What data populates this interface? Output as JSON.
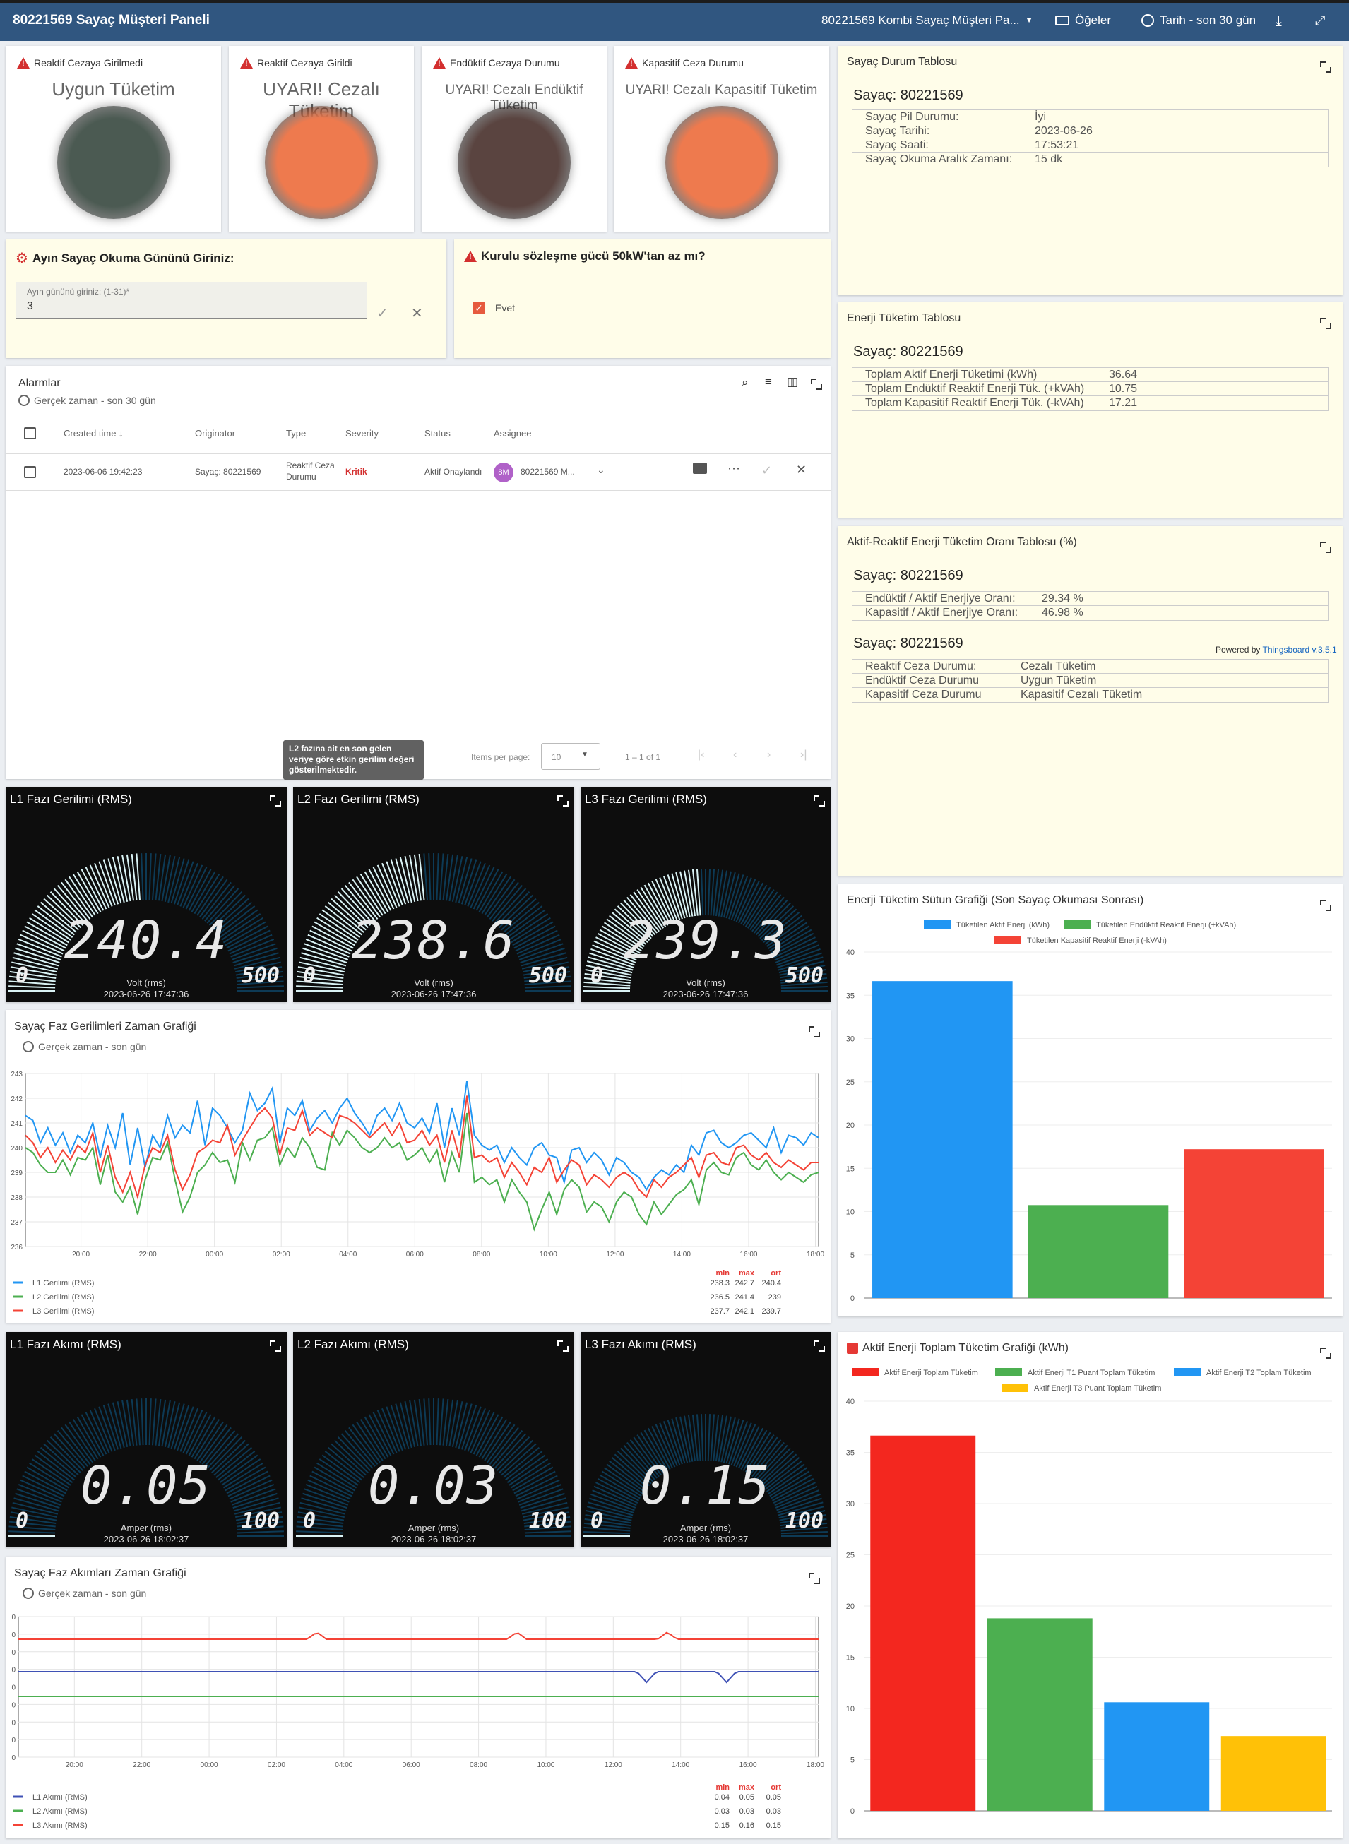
{
  "header": {
    "title": "80221569 Sayaç Müşteri Paneli",
    "dashboard_select": "80221569 Kombi Sayaç Müşteri Pa...",
    "entities": "Öğeler",
    "timewindow": "Tarih - son 30 gün"
  },
  "lamps": [
    {
      "label": "Reaktif Cezaya Girilmedi",
      "text": "Uygun Tüketim",
      "color": "#4b5a52"
    },
    {
      "label": "Reaktif Cezaya Girildi",
      "text": "UYARI! Cezalı Tüketim",
      "color": "#ee7a4e"
    },
    {
      "label": "Endüktif Cezaya Durumu",
      "text": "UYARI! Cezalı Endüktif Tüketim",
      "color": "#5a4440"
    },
    {
      "label": "Kapasitif Ceza Durumu",
      "text": "UYARI! Cezalı Kapasitif Tüketim",
      "color": "#ee7a4e"
    }
  ],
  "reading_day": {
    "title": "Ayın Sayaç Okuma Gününü Giriniz:",
    "field_label": "Ayın gününü giriniz: (1-31)*",
    "value": "3"
  },
  "contract": {
    "title": "Kurulu sözleşme gücü 50kW'tan az mı?",
    "checkbox_label": "Evet"
  },
  "alarms": {
    "title": "Alarmlar",
    "timewindow": "Gerçek zaman - son 30 gün",
    "columns": [
      "Created time",
      "Originator",
      "Type",
      "Severity",
      "Status",
      "Assignee"
    ],
    "row": {
      "time": "2023-06-06 19:42:23",
      "originator": "Sayaç: 80221569",
      "type": "Reaktif Ceza Durumu",
      "severity": "Kritik",
      "status": "Aktif Onaylandı",
      "avatar": "8M",
      "assignee": "80221569 M..."
    },
    "items_per_page_label": "Items per page:",
    "items_per_page": "10",
    "range": "1 – 1 of 1",
    "tooltip": "L2 fazına ait en son gelen veriye göre etkin gerilim değeri gösterilmektedir."
  },
  "status_table": {
    "title": "Sayaç Durum Tablosu",
    "meter": "Sayaç: 80221569",
    "rows": [
      {
        "k": "Sayaç Pil Durumu:",
        "v": "İyi"
      },
      {
        "k": "Sayaç Tarihi:",
        "v": "2023-06-26"
      },
      {
        "k": "Sayaç Saati:",
        "v": "17:53:21"
      },
      {
        "k": "Sayaç Okuma Aralık Zamanı:",
        "v": "15 dk"
      }
    ]
  },
  "energy_table": {
    "title": "Enerji Tüketim Tablosu",
    "meter": "Sayaç: 80221569",
    "rows": [
      {
        "k": "Toplam Aktif Enerji Tüketimi (kWh)",
        "v": "36.64"
      },
      {
        "k": "Toplam Endüktif Reaktif Enerji Tük. (+kVAh)",
        "v": "10.75"
      },
      {
        "k": "Toplam Kapasitif Reaktif Enerji Tük. (-kVAh)",
        "v": "17.21"
      }
    ]
  },
  "ratio_table": {
    "title": "Aktif-Reaktif Enerji Tüketim Oranı Tablosu (%)",
    "meter": "Sayaç: 80221569",
    "rows": [
      {
        "k": "Endüktif / Aktif Enerjiye Oranı:",
        "v": "29.34 %"
      },
      {
        "k": "Kapasitif / Aktif Enerjiye Oranı:",
        "v": "46.98 %"
      }
    ],
    "meter2": "Sayaç: 80221569",
    "powered": "Powered by",
    "powered_link": "Thingsboard v.3.5.1",
    "rows2": [
      {
        "k": "Reaktif Ceza Durumu:",
        "v": "Cezalı Tüketim"
      },
      {
        "k": "Endüktif Ceza Durumu",
        "v": "Uygun Tüketim"
      },
      {
        "k": "Kapasitif Ceza Durumu",
        "v": "Kapasitif Cezalı Tüketim"
      }
    ]
  },
  "voltage_gauges": [
    {
      "title": "L1 Fazı Gerilimi (RMS)",
      "value": "240.4",
      "min": "0",
      "max": "500",
      "unit": "Volt (rms)",
      "ts": "2023-06-26 17:47:36",
      "level": 0.4808
    },
    {
      "title": "L2 Fazı Gerilimi (RMS)",
      "value": "238.6",
      "min": "0",
      "max": "500",
      "unit": "Volt (rms)",
      "ts": "2023-06-26 17:47:36",
      "level": 0.4772
    },
    {
      "title": "L3 Fazı Gerilimi (RMS)",
      "value": "239.3",
      "min": "0",
      "max": "500",
      "unit": "Volt (rms)",
      "ts": "2023-06-26 17:47:36",
      "level": 0.4786
    }
  ],
  "current_gauges": [
    {
      "title": "L1 Fazı Akımı (RMS)",
      "value": "0.05",
      "min": "0",
      "max": "100",
      "unit": "Amper (rms)",
      "ts": "2023-06-26 18:02:37",
      "level": 0.0005
    },
    {
      "title": "L2 Fazı Akımı (RMS)",
      "value": "0.03",
      "min": "0",
      "max": "100",
      "unit": "Amper (rms)",
      "ts": "2023-06-26 18:02:37",
      "level": 0.0003
    },
    {
      "title": "L3 Fazı Akımı (RMS)",
      "value": "0.15",
      "min": "0",
      "max": "100",
      "unit": "Amper (rms)",
      "ts": "2023-06-26 18:02:37",
      "level": 0.0015
    }
  ],
  "voltage_chart_card": {
    "title": "Sayaç Faz Gerilimleri Zaman Grafiği",
    "timewindow": "Gerçek zaman - son gün"
  },
  "current_chart_card": {
    "title": "Sayaç Faz Akımları Zaman Grafiği",
    "timewindow": "Gerçek zaman - son gün"
  },
  "energy_bar_card": {
    "title": "Enerji Tüketim Sütun Grafiği (Son Sayaç Okuması Sonrası)"
  },
  "active_bar_card": {
    "title": "Aktif Enerji Toplam Tüketim Grafiği (kWh)"
  },
  "stats_header": {
    "min": "min",
    "max": "max",
    "avg": "ort"
  },
  "chart_data": [
    {
      "type": "line",
      "ylim": [
        236,
        243
      ],
      "yticks": [
        "236",
        "237",
        "238",
        "239",
        "240",
        "241",
        "242",
        "243"
      ],
      "xticks": [
        "20:00",
        "22:00",
        "00:00",
        "02:00",
        "04:00",
        "06:00",
        "08:00",
        "10:00",
        "12:00",
        "14:00",
        "16:00",
        "18:00"
      ],
      "series": [
        {
          "name": "L1 Gerilimi (RMS)",
          "color": "#2196f3",
          "min": "238.3",
          "max": "242.7",
          "avg": "240.4",
          "values": [
            241.3,
            241.1,
            240.2,
            240.8,
            240.1,
            240.6,
            239.8,
            240.5,
            240.2,
            241.0,
            239.6,
            240.9,
            240.0,
            241.4,
            239.3,
            240.8,
            239.2,
            240.5,
            240.0,
            241.3,
            240.4,
            240.9,
            240.6,
            241.9,
            240.1,
            241.6,
            241.3,
            240.8,
            240.2,
            240.7,
            242.2,
            241.5,
            241.8,
            242.4,
            240.2,
            241.6,
            241.3,
            241.9,
            240.7,
            241.2,
            241.5,
            241.0,
            241.6,
            242.0,
            241.4,
            241.0,
            240.5,
            241.3,
            241.6,
            241.1,
            241.8,
            241.0,
            240.8,
            241.2,
            240.6,
            241.8,
            240.0,
            241.6,
            240.5,
            242.7,
            240.5,
            240.1,
            239.9,
            240.1,
            239.4,
            240.0,
            239.6,
            239.3,
            240.0,
            240.2,
            239.7,
            239.6,
            238.6,
            239.9,
            240.0,
            239.4,
            239.8,
            239.5,
            238.9,
            239.6,
            239.4,
            239.0,
            238.8,
            238.3,
            238.8,
            239.1,
            238.9,
            239.3,
            239.0,
            240.1,
            239.7,
            240.6,
            240.7,
            240.2,
            240.0,
            240.2,
            240.5,
            240.6,
            240.3,
            240.0,
            240.8,
            239.8,
            240.5,
            240.4,
            240.1,
            240.6,
            240.4
          ]
        },
        {
          "name": "L2 Gerilimi (RMS)",
          "color": "#4caf50",
          "min": "236.5",
          "max": "241.4",
          "avg": "239",
          "values": [
            240.0,
            239.8,
            239.3,
            239.0,
            239.0,
            239.5,
            238.9,
            239.6,
            239.5,
            240.0,
            238.5,
            239.7,
            238.2,
            237.8,
            238.4,
            237.3,
            238.7,
            239.6,
            239.5,
            240.2,
            238.7,
            237.4,
            238.0,
            239.0,
            239.3,
            239.8,
            239.4,
            239.5,
            238.6,
            240.2,
            239.5,
            240.3,
            240.4,
            240.8,
            239.3,
            240.0,
            239.6,
            240.4,
            240.0,
            239.2,
            239.1,
            240.6,
            240.1,
            240.7,
            240.4,
            240.0,
            239.8,
            240.0,
            240.4,
            240.0,
            240.2,
            239.5,
            239.7,
            240.0,
            239.4,
            239.9,
            238.6,
            239.8,
            239.0,
            241.4,
            238.6,
            238.8,
            238.5,
            238.7,
            237.8,
            238.7,
            238.2,
            237.8,
            236.7,
            237.5,
            238.2,
            237.3,
            238.3,
            238.7,
            238.4,
            237.4,
            237.8,
            237.6,
            237.0,
            237.8,
            238.2,
            238.0,
            237.3,
            236.9,
            237.8,
            237.3,
            237.7,
            238.1,
            238.3,
            238.7,
            237.7,
            239.1,
            239.4,
            239.0,
            238.9,
            239.6,
            239.8,
            239.3,
            239.1,
            239.5,
            239.0,
            238.7,
            239.0,
            238.8,
            238.6,
            238.9,
            239.0
          ]
        },
        {
          "name": "L3 Gerilimi (RMS)",
          "color": "#f44336",
          "min": "237.7",
          "max": "242.1",
          "avg": "239.7",
          "values": [
            240.5,
            240.2,
            239.6,
            240.0,
            239.4,
            239.9,
            239.5,
            240.1,
            239.8,
            240.6,
            239.0,
            240.1,
            238.8,
            238.2,
            239.0,
            238.0,
            239.3,
            240.0,
            239.8,
            240.5,
            239.1,
            238.3,
            238.9,
            239.8,
            240.0,
            240.3,
            240.2,
            240.9,
            239.7,
            240.3,
            240.8,
            241.3,
            241.6,
            241.2,
            239.7,
            240.8,
            240.7,
            241.5,
            240.5,
            240.8,
            240.6,
            240.4,
            241.3,
            241.2,
            241.0,
            240.7,
            240.4,
            240.7,
            241.0,
            240.5,
            241.0,
            240.2,
            240.3,
            240.7,
            240.1,
            240.5,
            239.4,
            240.7,
            239.6,
            242.1,
            239.6,
            239.7,
            239.4,
            239.6,
            238.8,
            239.4,
            239.0,
            238.5,
            239.2,
            239.0,
            239.6,
            238.6,
            239.1,
            239.5,
            239.3,
            238.5,
            238.9,
            238.7,
            238.4,
            238.8,
            239.0,
            238.8,
            238.3,
            238.0,
            238.7,
            238.4,
            238.8,
            239.0,
            239.3,
            239.6,
            238.8,
            239.7,
            239.8,
            239.4,
            239.3,
            240.0,
            240.1,
            239.7,
            239.5,
            239.8,
            239.4,
            239.2,
            239.5,
            239.3,
            239.1,
            239.4,
            239.4
          ]
        }
      ]
    },
    {
      "type": "line",
      "yticks": [
        "0",
        "0",
        "0",
        "0",
        "0",
        "0",
        "0",
        "0",
        "0"
      ],
      "xticks": [
        "20:00",
        "22:00",
        "00:00",
        "02:00",
        "04:00",
        "06:00",
        "08:00",
        "10:00",
        "12:00",
        "14:00",
        "16:00",
        "18:00"
      ],
      "series": [
        {
          "name": "L1 Akımı (RMS)",
          "color": "#3f51b5",
          "min": "0.04",
          "max": "0.05",
          "avg": "0.05"
        },
        {
          "name": "L2 Akımı (RMS)",
          "color": "#4caf50",
          "min": "0.03",
          "max": "0.03",
          "avg": "0.03"
        },
        {
          "name": "L3 Akımı (RMS)",
          "color": "#f44336",
          "min": "0.15",
          "max": "0.16",
          "avg": "0.15"
        }
      ]
    },
    {
      "type": "bar",
      "ylim": [
        0,
        40
      ],
      "yticks": [
        "0",
        "5",
        "10",
        "15",
        "20",
        "25",
        "30",
        "35",
        "40"
      ],
      "series": [
        {
          "name": "Tüketilen Aktif Enerji (kWh)",
          "color": "#2196f3",
          "value": 36.64
        },
        {
          "name": "Tüketilen Endüktif Reaktif Enerji (+kVAh)",
          "color": "#4caf50",
          "value": 10.75
        },
        {
          "name": "Tüketilen Kapasitif Reaktif Enerji (-kVAh)",
          "color": "#f44336",
          "value": 17.21
        }
      ]
    },
    {
      "type": "bar",
      "ylim": [
        0,
        40
      ],
      "yticks": [
        "0",
        "5",
        "10",
        "15",
        "20",
        "25",
        "30",
        "35",
        "40"
      ],
      "series": [
        {
          "name": "Aktif Enerji Toplam Tüketim",
          "color": "#f3271f",
          "value": 36.64
        },
        {
          "name": "Aktif Enerji T1 Puant Toplam Tüketim",
          "color": "#4caf50",
          "value": 18.8
        },
        {
          "name": "Aktif Enerji T2 Toplam Tüketim",
          "color": "#2196f3",
          "value": 10.6
        },
        {
          "name": "Aktif Enerji T3 Puant Toplam Tüketim",
          "color": "#ffc107",
          "value": 7.3
        }
      ]
    }
  ]
}
